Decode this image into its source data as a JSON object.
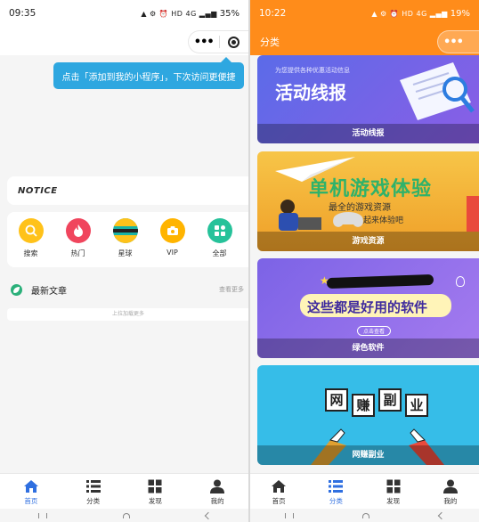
{
  "left": {
    "status": {
      "time": "09:35",
      "icons": "▲ ⚙ ⏰ HD 4G ▂▄▆",
      "battery": "35%"
    },
    "capsule": {
      "more": "•••"
    },
    "tooltip": "点击「添加到我的小程序」，下次访问更便捷",
    "notice": "NOTICE",
    "grid": [
      {
        "label": "搜索",
        "icon": "search-icon",
        "color": "#ffc21a"
      },
      {
        "label": "热门",
        "icon": "flame-icon",
        "color": "#f0455d"
      },
      {
        "label": "星球",
        "icon": "planet-icon",
        "color": "#19b3a6"
      },
      {
        "label": "VIP",
        "icon": "camera-icon",
        "color": "#ffb400"
      },
      {
        "label": "全部",
        "icon": "grid-icon",
        "color": "#26c29a"
      }
    ],
    "latest": {
      "title": "最新文章",
      "more": "查看更多"
    },
    "load_more": "上拉加载更多",
    "tabs": [
      {
        "label": "首页",
        "icon": "home-icon",
        "active": true
      },
      {
        "label": "分类",
        "icon": "list-icon",
        "active": false
      },
      {
        "label": "发现",
        "icon": "grid-squares-icon",
        "active": false
      },
      {
        "label": "我的",
        "icon": "user-icon",
        "active": false
      }
    ]
  },
  "right": {
    "status": {
      "time": "10:22",
      "icons": "▲ ⚙ ⏰ HD 4G ▂▄▆",
      "battery": "19%"
    },
    "header": {
      "title": "分类",
      "more": "•••"
    },
    "banners": [
      {
        "heading": "活动线报",
        "subtext": "为您提供各种优惠活动信息",
        "caption": "活动线报",
        "bg": "#6c5fe0"
      },
      {
        "heading": "单机游戏体验",
        "subtext": "最全的游戏资源",
        "subtext2": "一起来体验吧",
        "caption": "游戏资源",
        "bg": "#f2b233"
      },
      {
        "heading": "这些都是好用的软件",
        "subtext": "点击查看",
        "caption": "绿色软件",
        "bg": "#8a6be6"
      },
      {
        "heading_chars": [
          "网",
          "赚",
          "副",
          "业"
        ],
        "caption": "网赚副业",
        "bg": "#36bde8"
      }
    ],
    "tabs": [
      {
        "label": "首页",
        "icon": "home-icon",
        "active": false
      },
      {
        "label": "分类",
        "icon": "list-icon",
        "active": true
      },
      {
        "label": "发现",
        "icon": "grid-squares-icon",
        "active": false
      },
      {
        "label": "我的",
        "icon": "user-icon",
        "active": false
      }
    ]
  },
  "colors": {
    "accent": "#ff8c1a",
    "tab_active": "#2f6fe0",
    "tooltip": "#2ea7e0"
  }
}
